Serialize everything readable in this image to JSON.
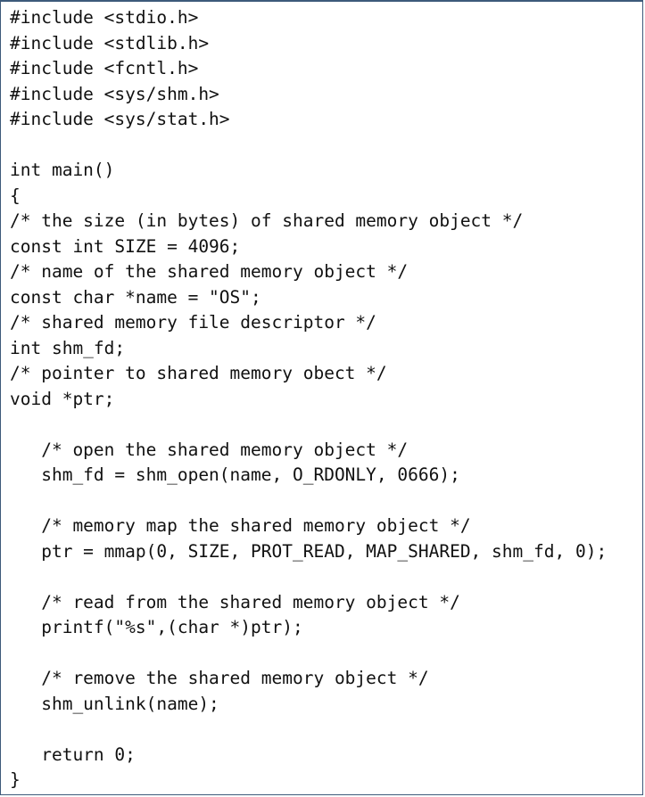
{
  "code_lines": [
    "#include <stdio.h>",
    "#include <stdlib.h>",
    "#include <fcntl.h>",
    "#include <sys/shm.h>",
    "#include <sys/stat.h>",
    "",
    "int main()",
    "{",
    "/* the size (in bytes) of shared memory object */",
    "const int SIZE = 4096;",
    "/* name of the shared memory object */",
    "const char *name = \"OS\";",
    "/* shared memory file descriptor */",
    "int shm_fd;",
    "/* pointer to shared memory obect */",
    "void *ptr;",
    "",
    "   /* open the shared memory object */",
    "   shm_fd = shm_open(name, O_RDONLY, 0666);",
    "",
    "   /* memory map the shared memory object */",
    "   ptr = mmap(0, SIZE, PROT_READ, MAP_SHARED, shm_fd, 0);",
    "",
    "   /* read from the shared memory object */",
    "   printf(\"%s\",(char *)ptr);",
    "",
    "   /* remove the shared memory object */",
    "   shm_unlink(name);",
    "",
    "   return 0;",
    "}"
  ]
}
